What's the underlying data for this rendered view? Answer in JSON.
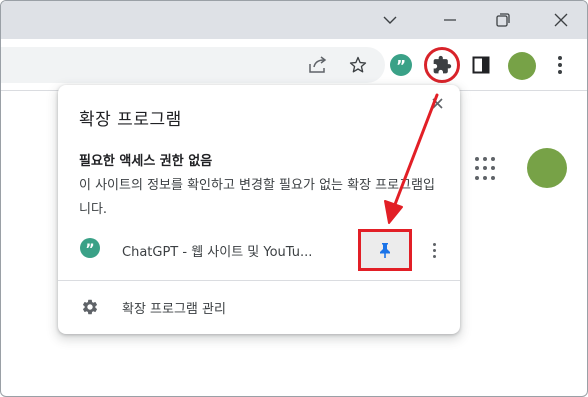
{
  "colors": {
    "titlebar": "#dee1e6",
    "accent_red": "#e21f26",
    "avatar_green": "#77a247",
    "chatgpt_logo": "#3aa187",
    "pin_blue": "#1a73e8"
  },
  "titlebar": {
    "buttons": [
      {
        "icon": "chevron-down-icon"
      },
      {
        "icon": "restore-icon"
      },
      {
        "icon": "close-icon"
      }
    ]
  },
  "toolbar": {
    "icons": [
      "share-icon",
      "bookmark-star-icon",
      "chatgpt-extension-icon",
      "extensions-puzzle-icon",
      "side-panel-icon",
      "profile-avatar",
      "menu-kebab-icon"
    ]
  },
  "popup": {
    "title": "확장 프로그램",
    "section_title": "필요한 액세스 권한 없음",
    "section_desc": "이 사이트의 정보를 확인하고 변경할 필요가 없는 확장 프로그램입니다.",
    "extension": {
      "name": "ChatGPT - 웹 사이트 및 YouTu...",
      "pinned": false
    },
    "manage_label": "확장 프로그램 관리"
  }
}
